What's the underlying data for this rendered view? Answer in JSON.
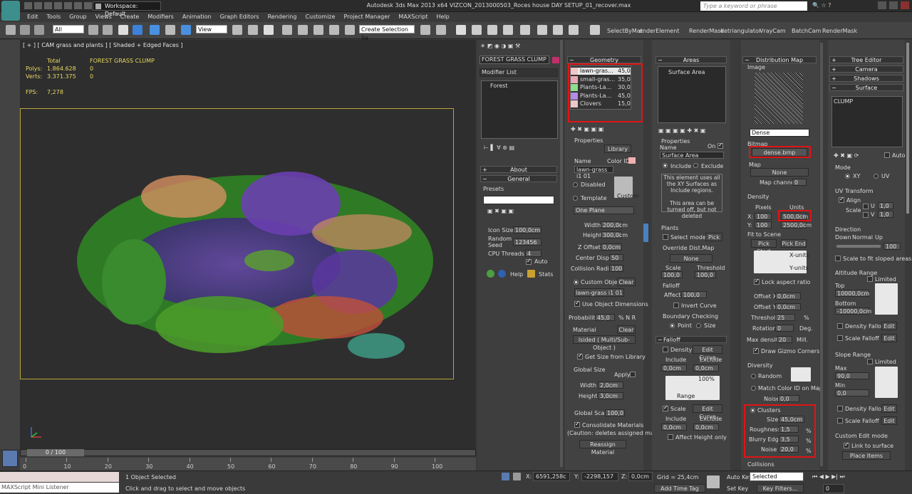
{
  "title_bar": {
    "workspace": "Workspace: Default",
    "app_title": "Autodesk 3ds Max  2013 x64      VIZCON_2013000503_Roces house DAY SETUP_01_recover.max",
    "search_placeholder": "Type a keyword or phrase"
  },
  "menu": [
    "Edit",
    "Tools",
    "Group",
    "Views",
    "Create",
    "Modifiers",
    "Animation",
    "Graph Editors",
    "Rendering",
    "Customize",
    "Project Manager",
    "MAXScript",
    "Help"
  ],
  "toolbar": {
    "selection_filter": "All",
    "ref_coord": "View",
    "named_selection": "Create Selection Se",
    "labels": [
      "SelectByMat",
      "enderElement",
      "RenderMask",
      "detriangulator",
      "VrayCam",
      "BatchCam",
      "RenderMask"
    ]
  },
  "viewport": {
    "label": "[ + ] [ CAM grass and plants ] [ Shaded + Edged Faces ]",
    "stats": {
      "total_label": "Total",
      "object_label": "FOREST GRASS CLUMP",
      "polys_label": "Polys:",
      "polys_total": "1.864.628",
      "polys_obj": "0",
      "verts_label": "Verts:",
      "verts_total": "3.371.375",
      "verts_obj": "0",
      "fps_label": "FPS:",
      "fps_value": "7,278"
    }
  },
  "timeline": {
    "frame_display": "0 / 100",
    "ticks": [
      "0",
      "10",
      "20",
      "30",
      "40",
      "50",
      "60",
      "70",
      "80",
      "90",
      "100"
    ]
  },
  "status": {
    "maxscript_label": "MAXScript Mini Listener",
    "selected": "1 Object Selected",
    "prompt": "Click and drag to select and move objects",
    "x_label": "X:",
    "x_val": "6591,258c",
    "y_label": "Y:",
    "y_val": "-2298,157",
    "z_label": "Z:",
    "z_val": "0,0cm",
    "grid": "Grid = 25,4cm",
    "add_time_tag": "Add Time Tag",
    "auto_key": "Auto Key",
    "key_mode": "Selected",
    "set_key": "Set Key",
    "key_filters": "Key Filters...",
    "frame": "0"
  },
  "modify_panel": {
    "object_name": "FOREST GRASS CLUMP",
    "object_color": "#c0306a",
    "modifier_list": "Modifier List",
    "stack_item": "Forest",
    "about_head": "About",
    "general_head": "General",
    "presets_label": "Presets",
    "icon_size_label": "Icon Size",
    "icon_size_value": "100,0cm",
    "random_seed_label": "Random Seed",
    "random_seed_value": "123456",
    "cpu_threads_label": "CPU Threads",
    "cpu_threads_value": "4",
    "auto_label": "Auto",
    "help_label": "Help",
    "stats_label": "Stats"
  },
  "geometry": {
    "head": "Geometry",
    "items": [
      {
        "name": "lawn-gras...",
        "value": "45,0",
        "color": "#f3c7c7"
      },
      {
        "name": "small-gras...",
        "value": "35,0",
        "color": "#e8a8b8"
      },
      {
        "name": "Plants-La...",
        "value": "30,0",
        "color": "#8ce08c"
      },
      {
        "name": "Plants-La...",
        "value": "45,0",
        "color": "#b28ce8"
      },
      {
        "name": "Clovers",
        "value": "15,0",
        "color": "#f0c8c8"
      }
    ],
    "properties_label": "Properties",
    "library_btn": "Library",
    "name_label": "Name",
    "color_id_label": "Color ID",
    "name_value": "lawn-grass i1 01",
    "disabled_label": "Disabled",
    "template_label": "Template",
    "custom_label": "Custom",
    "one_plane": "One Plane",
    "width_label": "Width",
    "width_value": "200,0cm",
    "height_label": "Height",
    "height_value": "300,0cm",
    "zoffset_label": "Z Offset",
    "zoffset_value": "0,0cm",
    "center_label": "Center Displ.",
    "center_value": "50",
    "collision_label": "Collision Radius",
    "collision_value": "100",
    "custom_object_label": "Custom Object",
    "clear_btn": "Clear",
    "custom_object_value": "lawn-grass i1 01",
    "use_dims_label": "Use Object Dimensions",
    "probability_label": "Probability",
    "probability_value": "45,0",
    "material_label": "Material",
    "material_clear": "Clear",
    "material_value": "lsided  ( Multi/Sub-Object )",
    "get_size_label": "Get Size from Library",
    "global_size_label": "Global Size",
    "apply_label": "Apply",
    "gs_width_label": "Width",
    "gs_width_value": "2,0cm",
    "gs_height_label": "Height",
    "gs_height_value": "3,0cm",
    "global_scale_label": "Global Scale",
    "global_scale_value": "100,0",
    "consolidate_label": "Consolidate Materials",
    "consolidate_note": "(Caution: deletes assigned mat!)",
    "reassign_btn": "Reassign Material"
  },
  "areas": {
    "head": "Areas",
    "list_item": "Surface Area",
    "properties_label": "Properties",
    "name_label": "Name",
    "on_label": "On",
    "name_value": "Surface Area",
    "include_label": "Include",
    "exclude_label": "Exclude",
    "note": "This element uses all the XY Surfaces as Include regions.\n\nThis area can be turned off, but not deleted",
    "plants_label": "Plants",
    "select_models_label": "Select models",
    "pick_btn": "Pick",
    "override_label": "Override Dist.Map",
    "none_btn": "None",
    "scale_label": "Scale",
    "threshold_label": "Threshold",
    "scale_value": "100,0",
    "threshold_value": "100,0",
    "falloff_label": "Falloff",
    "affect_label": "Affect",
    "affect_value": "100,0",
    "invert_label": "Invert Curve",
    "boundary_label": "Boundary Checking",
    "point_label": "Point",
    "size_label": "Size",
    "falloff2_head": "Falloff",
    "density_label": "Density",
    "edit_curve": "Edit Curve",
    "include2": "Include",
    "exclude2": "Exclude",
    "inc_value": "0,0cm",
    "exc_value": "0,0cm",
    "scale2_label": "Scale",
    "edit_curve2": "Edit Curve",
    "include3": "Include",
    "exclude3": "Exclude",
    "inc3_value": "0,0cm",
    "exc3_value": "0,0cm",
    "affect_height": "Affect Height only",
    "range_label": "Range",
    "pct_label": "100%"
  },
  "distribution": {
    "head": "Distribution Map",
    "image_label": "Image",
    "preset": "Dense",
    "bitmap_label": "Bitmap",
    "bitmap_value": "dense.bmp",
    "map_label": "Map",
    "map_btn": "None",
    "map_channel_label": "Map channel",
    "map_channel_value": "0",
    "density_label": "Density",
    "pixels_label": "Pixels",
    "units_label": "Units",
    "x_label": "X:",
    "y_label": "Y:",
    "x_pixels": "100",
    "y_pixels": "100",
    "x_units": "500,0cm",
    "y_units": "2500,0cm",
    "fit_label": "Fit to Scene",
    "pick_start": "Pick Start",
    "pick_end": "Pick End",
    "xunits": "X-units",
    "yunits": "Y-units",
    "lock_aspect": "Lock aspect ratio",
    "offx_label": "Offset X",
    "offx_value": "0,0cm",
    "offy_label": "Offset Y",
    "offy_value": "0,0cm",
    "threshold_label": "Threshold",
    "threshold_value": "25",
    "rotation_label": "Rotation",
    "rotation_value": "0",
    "deg_label": "Deg.",
    "maxdensity_label": "Max density",
    "maxdensity_value": "20",
    "mill_label": "Mill.",
    "drawgizmo_label": "Draw Gizmo Corners",
    "diversity_label": "Diversity",
    "random_label": "Random",
    "matchcolor_label": "Match Color ID on Map",
    "noise_label": "Noise",
    "noise_value": "0,0",
    "clusters_label": "Clusters",
    "c_size_label": "Size",
    "c_size_value": "45,0cm",
    "c_rough_label": "Roughness",
    "c_rough_value": "1,5",
    "c_blur_label": "Blurry Edge",
    "c_blur_value": "3,5",
    "c_noise_label": "Noise",
    "c_noise_value": "20,0",
    "collisions_label": "Collisions"
  },
  "tree_editor": {
    "heads": [
      "Tree Editor",
      "Camera",
      "Shadows",
      "Surface"
    ],
    "surface_item": "CLUMP",
    "auto_label": "Auto",
    "mode_label": "Mode",
    "xy_label": "XY",
    "uv_label": "UV",
    "uvt_label": "UV Transform",
    "align_label": "Align",
    "scale_label": "Scale",
    "u_label": "U",
    "v_label": "V",
    "u_value": "1,0",
    "v_value": "1,0",
    "direction_label": "Direction",
    "down_label": "Down",
    "normal_label": "Normal",
    "up_label": "Up",
    "dir_value": "100",
    "scale_slope": "Scale to fit sloped areas",
    "altitude_label": "Altitude Range",
    "limited_label": "Limited",
    "top_label": "Top",
    "top_value": "10000,0cm",
    "bottom_label": "Bottom",
    "bottom_value": "-10000,0cm",
    "density_falloff": "Density Falloff",
    "edit1": "Edit",
    "scale_falloff": "Scale Falloff",
    "edit2": "Edit",
    "slope_label": "Slope Range",
    "limited2": "Limited",
    "max_label": "Max",
    "max_value": "90,0",
    "min_label": "Min",
    "min_value": "0,0",
    "density_falloff2": "Density Falloff",
    "edit3": "Edit",
    "scale_falloff2": "Scale Falloff",
    "edit4": "Edit",
    "custom_edit": "Custom Edit mode",
    "link_surface": "Link to surface",
    "place_items": "Place Items"
  }
}
